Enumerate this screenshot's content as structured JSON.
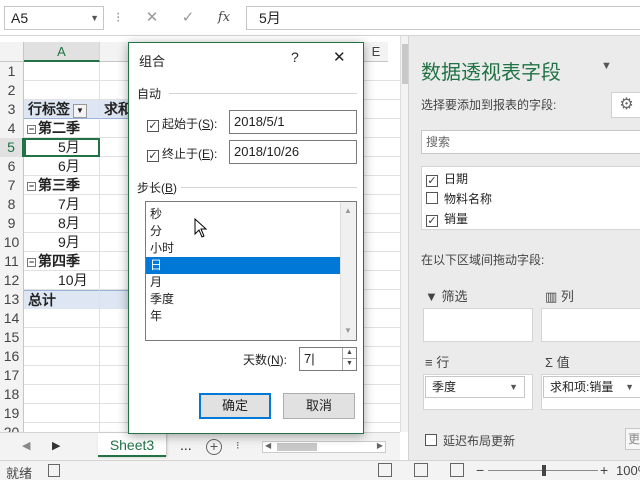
{
  "formula_bar": {
    "name_box": "A5",
    "formula_value": "5月",
    "cancel_glyph": "✕",
    "enter_glyph": "✓",
    "fx_glyph": "fx"
  },
  "grid": {
    "col_a": "A",
    "col_e": "E",
    "rows": [
      {
        "num": "1",
        "a": "",
        "b": ""
      },
      {
        "num": "2",
        "a": "",
        "b": ""
      },
      {
        "num": "3",
        "a": "行标签",
        "b": "求和"
      },
      {
        "num": "4",
        "a": "第二季",
        "b": ""
      },
      {
        "num": "5",
        "a": "5月",
        "b": ""
      },
      {
        "num": "6",
        "a": "6月",
        "b": ""
      },
      {
        "num": "7",
        "a": "第三季",
        "b": ""
      },
      {
        "num": "8",
        "a": "7月",
        "b": ""
      },
      {
        "num": "9",
        "a": "8月",
        "b": ""
      },
      {
        "num": "10",
        "a": "9月",
        "b": ""
      },
      {
        "num": "11",
        "a": "第四季",
        "b": ""
      },
      {
        "num": "12",
        "a": "10月",
        "b": ""
      },
      {
        "num": "13",
        "a": "总计",
        "b": ""
      },
      {
        "num": "14",
        "a": "",
        "b": ""
      },
      {
        "num": "15",
        "a": "",
        "b": ""
      },
      {
        "num": "16",
        "a": "",
        "b": ""
      },
      {
        "num": "17",
        "a": "",
        "b": ""
      },
      {
        "num": "18",
        "a": "",
        "b": ""
      },
      {
        "num": "19",
        "a": "",
        "b": ""
      },
      {
        "num": "20",
        "a": "",
        "b": ""
      }
    ]
  },
  "tabs": {
    "sheet_name": "Sheet3",
    "more": "..."
  },
  "status": {
    "ready": "就绪",
    "zoom": "100%"
  },
  "dialog": {
    "title": "组合",
    "help": "?",
    "close": "✕",
    "auto_label": "自动",
    "start_label": "起始于(",
    "start_key": "S",
    "start_value": "2018/5/1",
    "end_label": "终止于(",
    "end_key": "E",
    "end_value": "2018/10/26",
    "step_label": "步长(",
    "step_key": "B",
    "step_items": [
      "秒",
      "分",
      "小时",
      "日",
      "月",
      "季度",
      "年"
    ],
    "step_selected": "日",
    "days_label": "天数(",
    "days_key": "N",
    "days_value": "7",
    "ok_label": "确定",
    "cancel_label": "取消"
  },
  "pivot_pane": {
    "title": "数据透视表字段",
    "subtitle": "选择要添加到报表的字段:",
    "search_placeholder": "搜索",
    "fields": [
      {
        "name": "日期",
        "checked": true
      },
      {
        "name": "物料名称",
        "checked": false
      },
      {
        "name": "销量",
        "checked": true
      }
    ],
    "drag_hint": "在以下区域间拖动字段:",
    "filter_label": "筛选",
    "column_label": "列",
    "row_label": "行",
    "value_label": "值",
    "row_field": "季度",
    "value_field": "求和项:销量",
    "defer_label": "延迟布局更新",
    "update_button": "更"
  }
}
